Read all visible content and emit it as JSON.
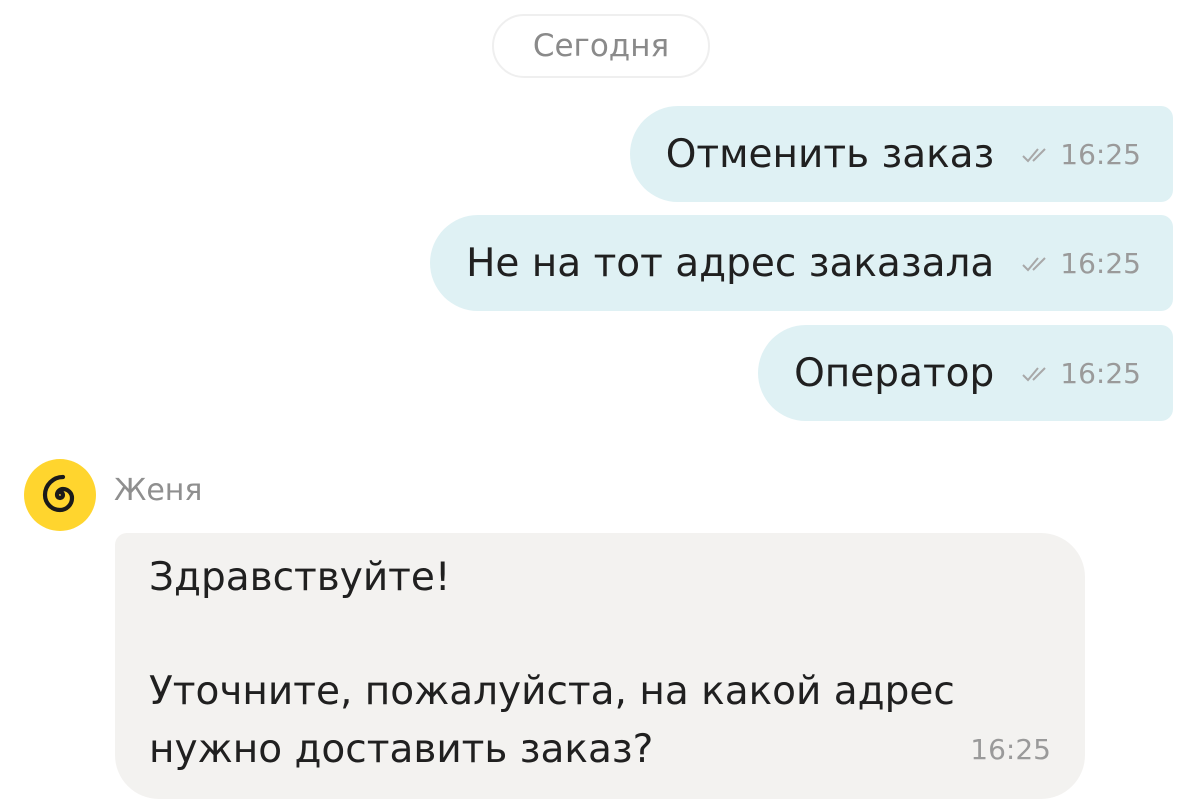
{
  "date_separator": "Сегодня",
  "outgoing_messages": [
    {
      "text": "Отменить заказ",
      "time": "16:25",
      "status": "read"
    },
    {
      "text": "Не на тот адрес заказала",
      "time": "16:25",
      "status": "read"
    },
    {
      "text": "Оператор",
      "time": "16:25",
      "status": "read"
    }
  ],
  "incoming_message": {
    "sender": "Женя",
    "avatar_icon": "spiral-logo-icon",
    "lines": [
      "Здравствуйте!",
      "Уточните, пожалуйста, на какой адрес",
      "нужно доставить заказ?"
    ],
    "time": "16:25"
  },
  "colors": {
    "outgoing_bubble": "#dff1f4",
    "incoming_bubble": "#f3f2f0",
    "avatar_bg": "#ffd52e"
  }
}
